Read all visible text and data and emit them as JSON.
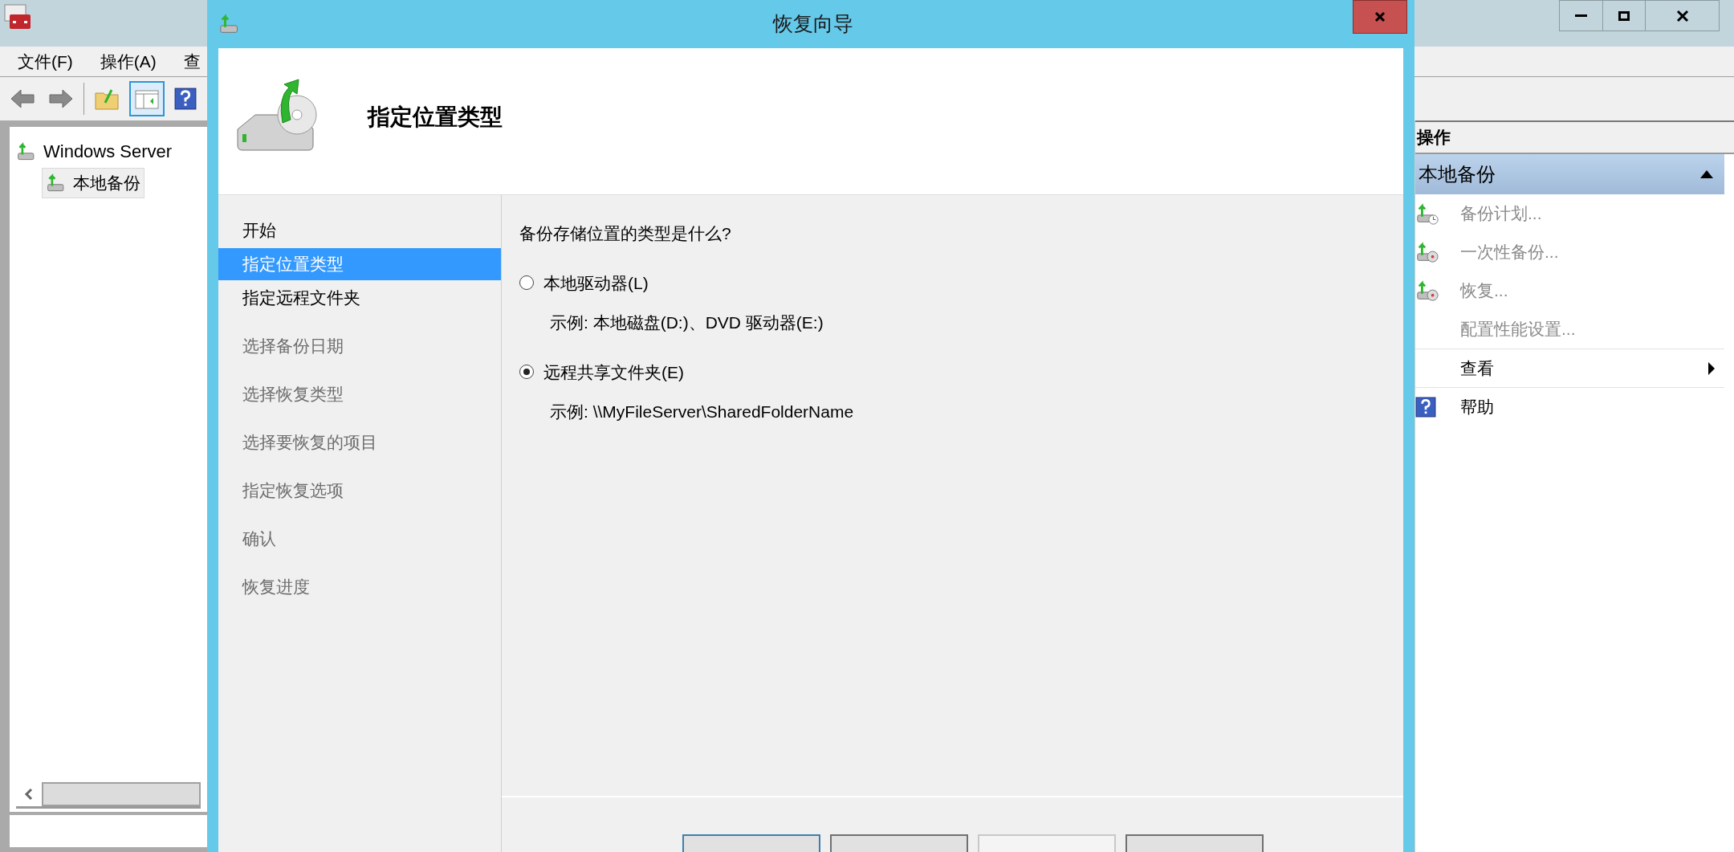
{
  "console": {
    "menu": [
      "文件(F)",
      "操作(A)",
      "查"
    ],
    "tree": {
      "label": "Windows Server",
      "children": [
        {
          "label": "本地备份",
          "selected": true
        }
      ]
    },
    "actions": {
      "header": "操作",
      "section": "本地备份",
      "expanded": true,
      "items": [
        {
          "label": "备份计划...",
          "kind": "schedule",
          "disabled": true
        },
        {
          "label": "一次性备份...",
          "kind": "backup",
          "disabled": true
        },
        {
          "label": "恢复...",
          "kind": "recover",
          "disabled": true
        },
        {
          "label": "配置性能设置...",
          "kind": "plain",
          "disabled": true
        },
        {
          "label": "查看",
          "kind": "submenu",
          "disabled": false
        },
        {
          "label": "帮助",
          "kind": "help",
          "disabled": false
        }
      ]
    }
  },
  "wizard": {
    "title": "恢复向导",
    "heading": "指定位置类型",
    "steps": [
      {
        "label": "开始",
        "selected": false,
        "disabled": false
      },
      {
        "label": "指定位置类型",
        "selected": true,
        "disabled": false
      },
      {
        "label": "指定远程文件夹",
        "selected": false,
        "disabled": false
      },
      {
        "label": "选择备份日期",
        "selected": false,
        "disabled": true
      },
      {
        "label": "选择恢复类型",
        "selected": false,
        "disabled": true
      },
      {
        "label": "选择要恢复的项目",
        "selected": false,
        "disabled": true
      },
      {
        "label": "指定恢复选项",
        "selected": false,
        "disabled": true
      },
      {
        "label": "确认",
        "selected": false,
        "disabled": true
      },
      {
        "label": "恢复进度",
        "selected": false,
        "disabled": true
      }
    ],
    "question": "备份存储位置的类型是什么?",
    "options": [
      {
        "label": "本地驱动器(L)",
        "example": "示例: 本地磁盘(D:)、DVD 驱动器(E:)",
        "selected": false
      },
      {
        "label": "远程共享文件夹(E)",
        "example": "示例: \\\\MyFileServer\\SharedFolderName",
        "selected": true
      }
    ],
    "buttons": [
      {
        "disabled": false,
        "focused": true
      },
      {
        "disabled": false,
        "focused": false
      },
      {
        "disabled": true,
        "focused": false
      },
      {
        "disabled": false,
        "focused": false
      }
    ]
  }
}
